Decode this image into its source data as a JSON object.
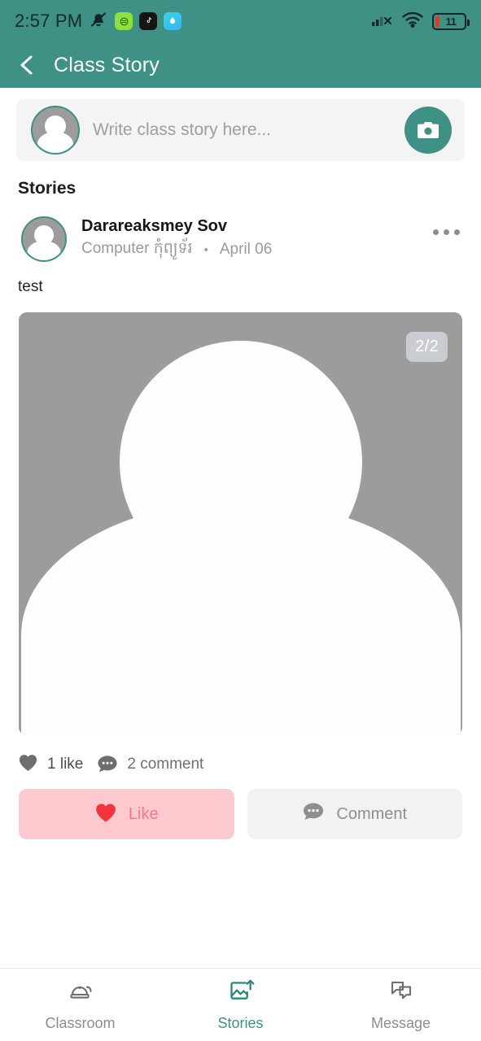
{
  "status_bar": {
    "time": "2:57 PM",
    "icons": [
      "bell-muted-icon",
      "app-icon-green",
      "app-icon-tiktok",
      "app-icon-blue"
    ],
    "signal": "signal-no-sim-icon",
    "wifi": "wifi-icon",
    "battery_level": "11"
  },
  "app_bar": {
    "back": "back-chevron-icon",
    "title": "Class Story"
  },
  "composer": {
    "avatar": "user-avatar",
    "placeholder": "Write class story here...",
    "value": "",
    "camera": "camera-icon"
  },
  "section": {
    "heading": "Stories"
  },
  "post": {
    "author": "Darareaksmey Sov",
    "class_name": "Computer កុំព្យូទ័រ",
    "separator": "•",
    "date": "April 06",
    "menu": "more-options-icon",
    "text": "test",
    "media": {
      "counter": "2/2",
      "watermark": "dreamstime"
    },
    "like_count": "1 like",
    "comment_count": "2 comment",
    "actions": {
      "like_label": "Like",
      "comment_label": "Comment"
    }
  },
  "bottom_nav": {
    "items": [
      {
        "label": "Classroom",
        "icon": "school-bell-icon",
        "active": false
      },
      {
        "label": "Stories",
        "icon": "image-upload-icon",
        "active": true
      },
      {
        "label": "Message",
        "icon": "chat-bubbles-icon",
        "active": false
      }
    ]
  },
  "colors": {
    "brand_teal": "#3E9184",
    "like_pink_bg": "#FCC9CE",
    "like_red": "#F2353C",
    "battery_red": "#EE3322"
  }
}
